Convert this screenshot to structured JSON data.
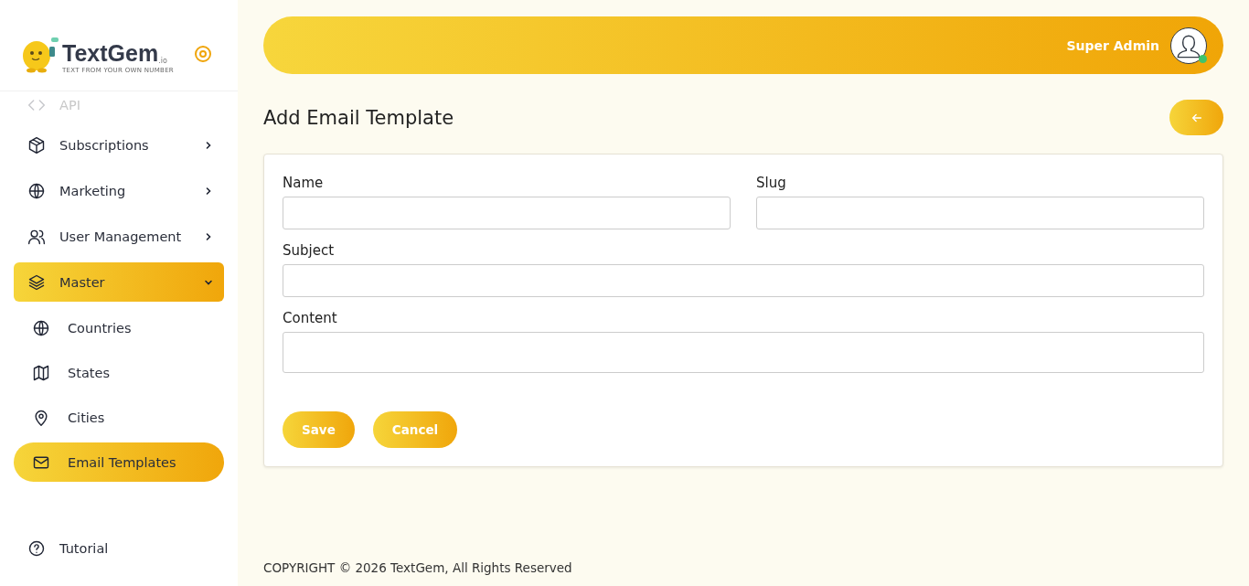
{
  "brand": {
    "name": "TextGem",
    "suffix": ".io",
    "tagline": "TEXT FROM YOUR OWN NUMBER"
  },
  "sidebar": {
    "items": [
      {
        "label": "API",
        "selected": false
      },
      {
        "label": "Subscriptions",
        "selected": false,
        "expanded": false
      },
      {
        "label": "Marketing",
        "selected": false,
        "expanded": false
      },
      {
        "label": "User Management",
        "selected": false,
        "expanded": false
      },
      {
        "label": "Master",
        "selected": true,
        "expanded": true,
        "children": [
          {
            "label": "Countries",
            "selected": false
          },
          {
            "label": "States",
            "selected": false
          },
          {
            "label": "Cities",
            "selected": false
          },
          {
            "label": "Email Templates",
            "selected": true
          }
        ]
      },
      {
        "label": "Tutorial",
        "selected": false
      }
    ]
  },
  "header": {
    "user": "Super Admin",
    "online": true
  },
  "page": {
    "title": "Add Email Template"
  },
  "form": {
    "fields": [
      {
        "label": "Name",
        "kind": "half"
      },
      {
        "label": "Slug",
        "kind": "half"
      },
      {
        "label": "Subject",
        "kind": "full"
      },
      {
        "label": "Content",
        "kind": "area"
      }
    ],
    "buttons": [
      "Save",
      "Cancel"
    ]
  },
  "footer": "COPYRIGHT © 2026 TextGem, All Rights Reserved"
}
